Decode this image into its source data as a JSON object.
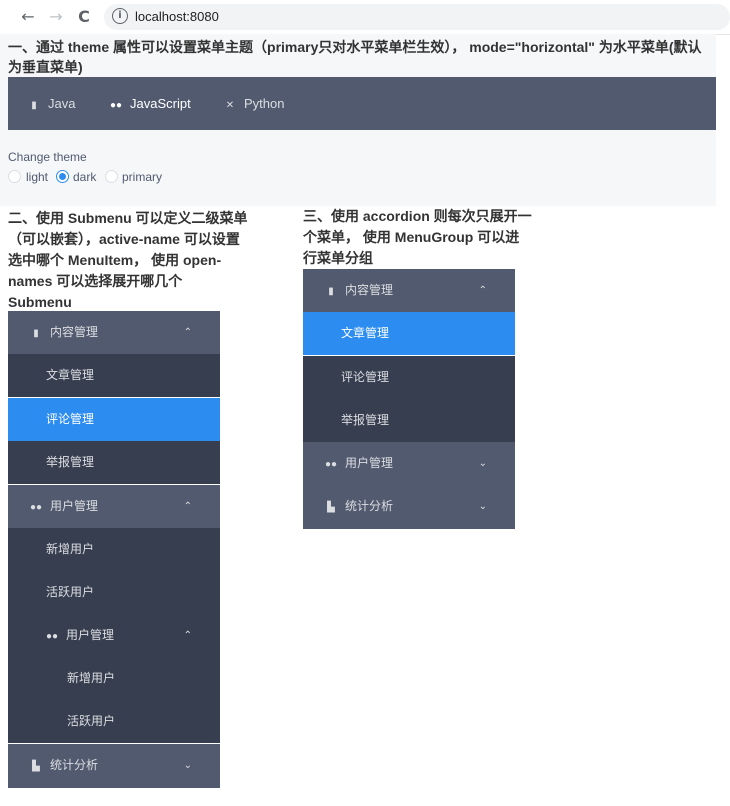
{
  "browser": {
    "back": "←",
    "forward": "→",
    "reload": "C",
    "url": "localhost:8080"
  },
  "section1": {
    "heading": "一、通过 theme 属性可以设置菜单主题（primary只对水平菜单栏生效）， mode=\"horizontal\" 为水平菜单(默认为垂直菜单)",
    "hmenu": [
      {
        "label": "Java",
        "icon": "document-icon",
        "active": false
      },
      {
        "label": "JavaScript",
        "icon": "users-icon",
        "active": true
      },
      {
        "label": "Python",
        "icon": "tools-icon",
        "active": false
      }
    ],
    "change_theme_label": "Change theme",
    "radios": [
      {
        "label": "light",
        "checked": false
      },
      {
        "label": "dark",
        "checked": true
      },
      {
        "label": "primary",
        "checked": false
      }
    ]
  },
  "section2": {
    "heading": "二、使用 Submenu 可以定义二级菜单（可以嵌套），active-name 可以设置选中哪个 MenuItem， 使用 open-names 可以选择展开哪几个 Submenu",
    "menu": {
      "content": {
        "label": "内容管理",
        "icon": "document-icon",
        "arrow": "⌃"
      },
      "article": "文章管理",
      "comment": "评论管理",
      "report": "举报管理",
      "users": {
        "label": "用户管理",
        "icon": "users-icon",
        "arrow": "⌃"
      },
      "add_user": "新增用户",
      "active_user": "活跃用户",
      "users_nested": {
        "label": "用户管理",
        "icon": "users-icon",
        "arrow": "⌃"
      },
      "nested_add_user": "新增用户",
      "nested_active_user": "活跃用户",
      "stats": {
        "label": "统计分析",
        "icon": "stats-icon",
        "arrow": "⌄"
      }
    }
  },
  "section3": {
    "heading": "三、使用 accordion 则每次只展开一个菜单， 使用 MenuGroup 可以进行菜单分组",
    "menu": {
      "content": {
        "label": "内容管理",
        "icon": "document-icon",
        "arrow": "⌃"
      },
      "article": "文章管理",
      "comment": "评论管理",
      "report": "举报管理",
      "users": {
        "label": "用户管理",
        "icon": "users-icon",
        "arrow": "⌄"
      },
      "stats": {
        "label": "统计分析",
        "icon": "stats-icon",
        "arrow": "⌄"
      }
    }
  },
  "colors": {
    "menu_dark": "#515a6e",
    "menu_item_dark": "#363e4f",
    "active_blue": "#2d8cf0",
    "panel_bg": "#f5f7f9"
  }
}
